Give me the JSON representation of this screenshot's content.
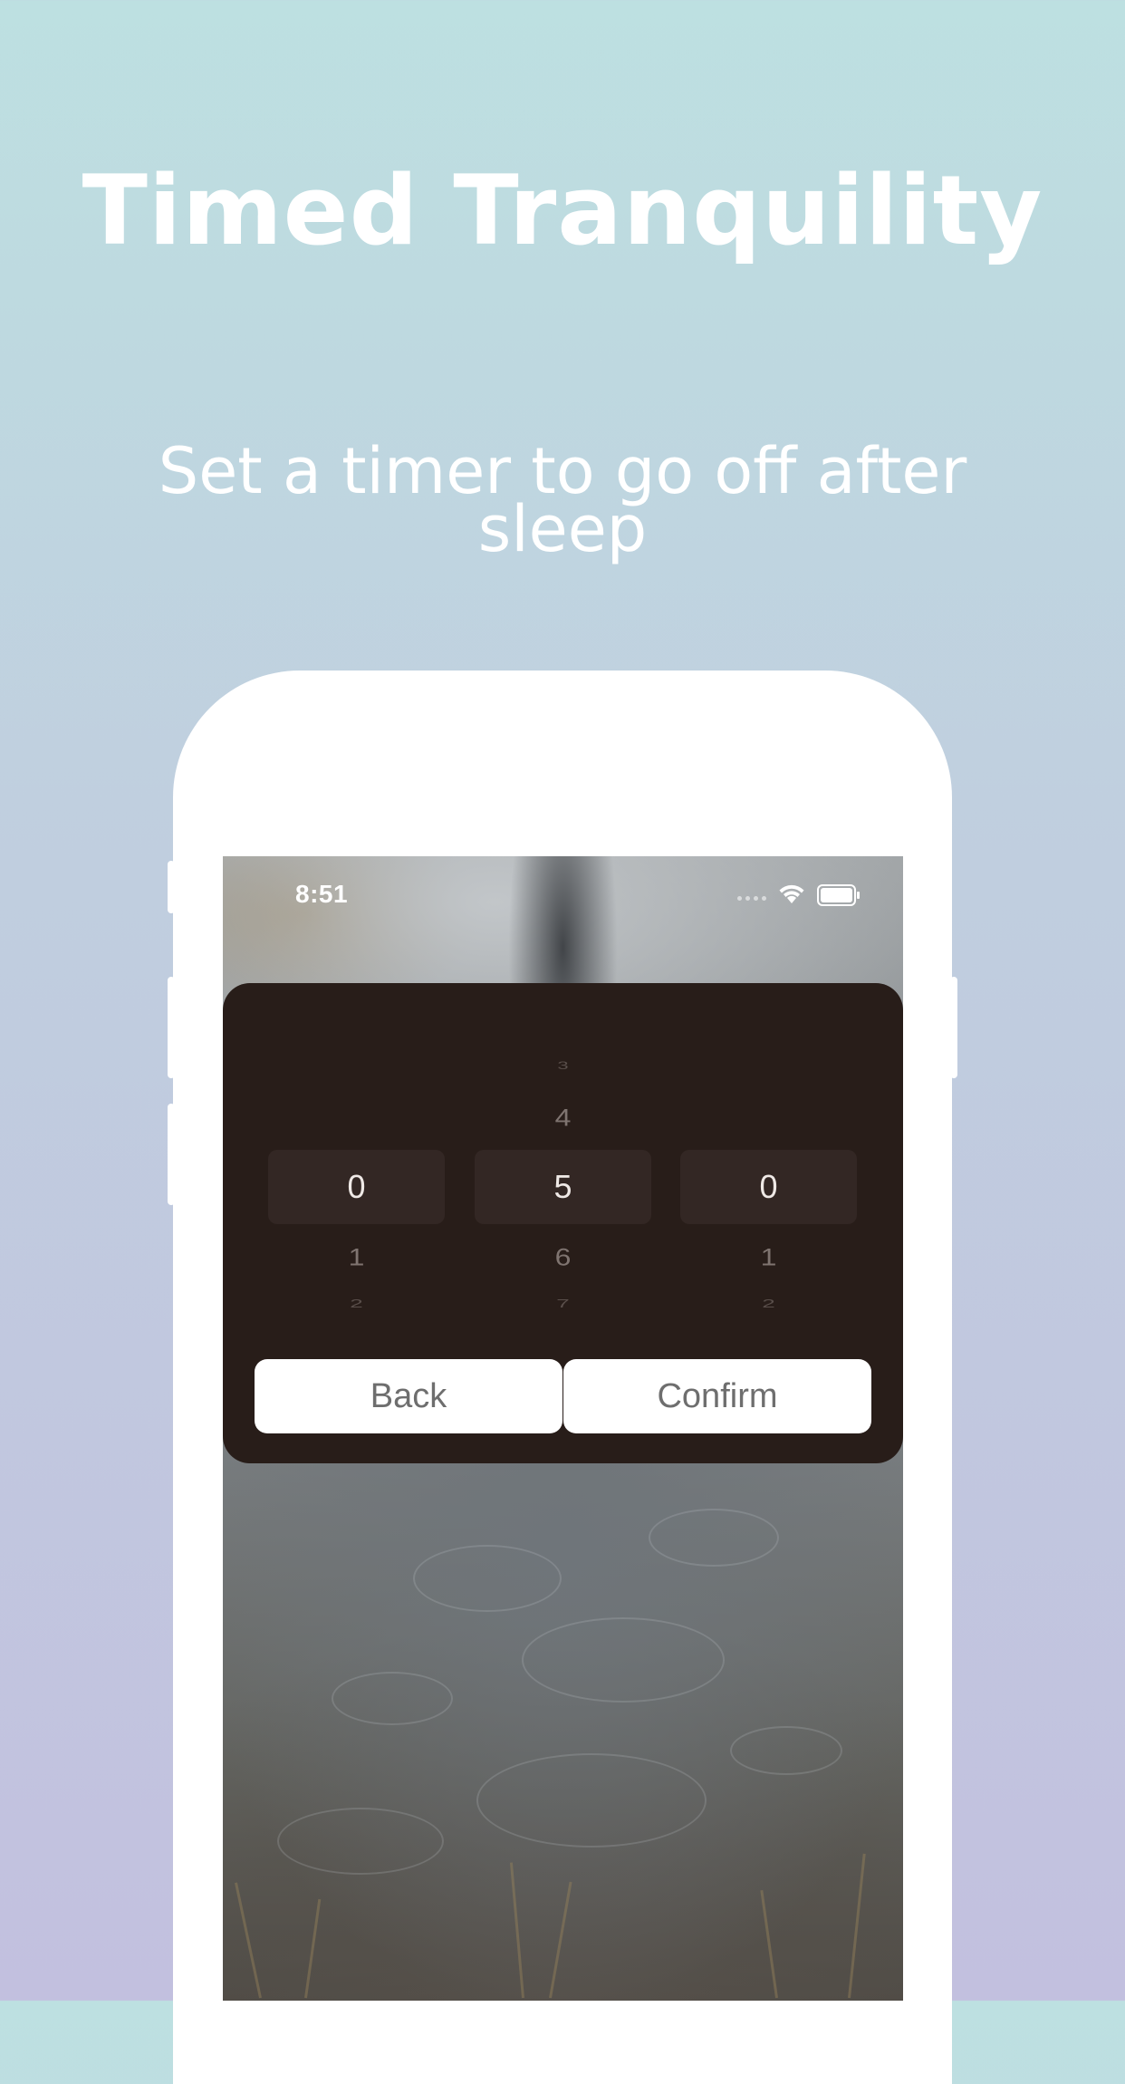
{
  "promo": {
    "headline": "Timed Tranquility",
    "subheadline": "Set a timer to go off after sleep"
  },
  "status_bar": {
    "time": "8:51",
    "wifi_icon": "wifi-icon",
    "battery_icon": "battery-icon"
  },
  "timer_picker": {
    "columns": [
      {
        "name": "hours",
        "above": [
          "",
          ""
        ],
        "selected": "0",
        "below": [
          "1",
          "2"
        ]
      },
      {
        "name": "minutes",
        "above": [
          "3",
          "4"
        ],
        "selected": "5",
        "below": [
          "6",
          "7"
        ]
      },
      {
        "name": "seconds",
        "above": [
          "",
          ""
        ],
        "selected": "0",
        "below": [
          "1",
          "2"
        ]
      }
    ],
    "back_label": "Back",
    "confirm_label": "Confirm"
  },
  "colors": {
    "panel_background": "#281d19",
    "selection_highlight": "#332724",
    "page_gradient_top": "#bde0e1",
    "page_gradient_bottom": "#c2c0df"
  }
}
